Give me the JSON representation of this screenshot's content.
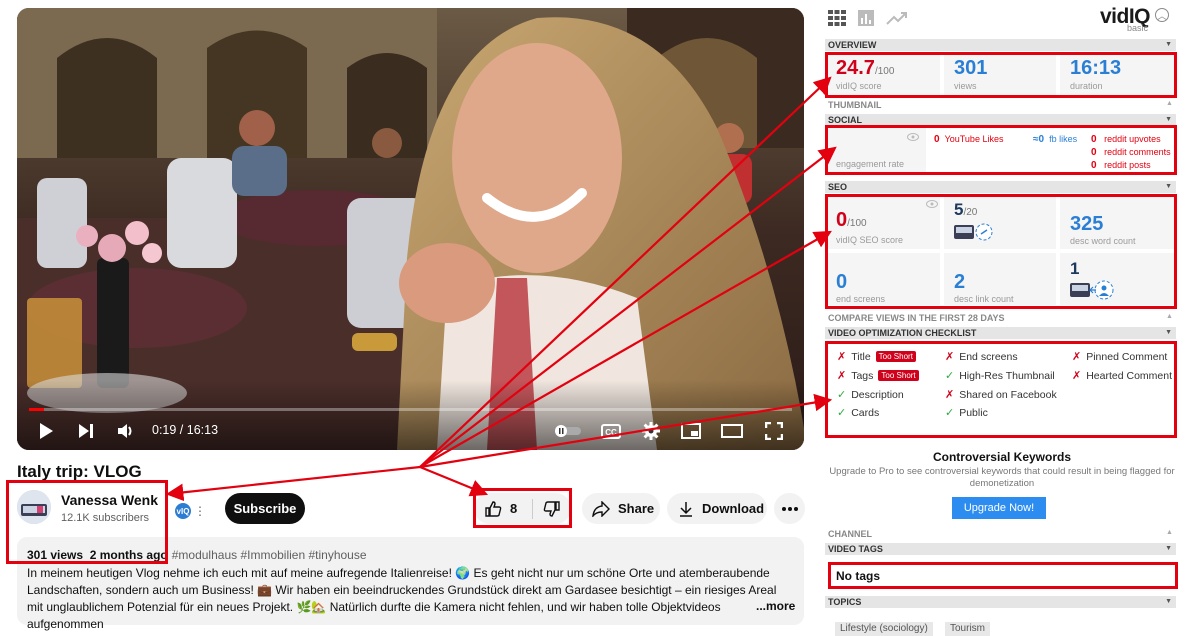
{
  "player": {
    "time": "0:19 / 16:13",
    "progress_fraction": 0.02
  },
  "video": {
    "title": "Italy trip: VLOG"
  },
  "channel": {
    "name": "Vanessa Wenk",
    "subscribers": "12.1K subscribers",
    "subscribe_label": "Subscribe",
    "vidiq_badge": "vIQ"
  },
  "actions": {
    "likes": "8",
    "share": "Share",
    "download": "Download"
  },
  "description": {
    "views": "301 views",
    "age": "2 months ago",
    "hashtags": "#modulhaus #Immobilien #tinyhouse",
    "text": "In meinem heutigen Vlog nehme ich euch mit auf meine aufregende Italienreise! 🌍 Es geht nicht nur um schöne Orte und atemberaubende Landschaften, sondern auch um Business! 💼 Wir haben ein beeindruckendes Grundstück direkt am Gardasee besichtigt – ein riesiges Areal mit unglaublichem Potenzial für ein neues Projekt. 🌿🏡 Natürlich durfte die Kamera nicht fehlen, und wir haben tolle Objektvideos aufgenommen",
    "more": "...more"
  },
  "vidiq": {
    "logo_main": "vid",
    "logo_iq": "IQ",
    "plan": "basic",
    "sections": {
      "overview": "OVERVIEW",
      "thumbnail": "THUMBNAIL",
      "social": "SOCIAL",
      "seo": "SEO",
      "compare": "COMPARE VIEWS IN THE FIRST 28 DAYS",
      "checklist": "VIDEO OPTIMIZATION CHECKLIST",
      "channel": "CHANNEL",
      "tags": "VIDEO TAGS",
      "topics": "TOPICS"
    },
    "overview": {
      "score": "24.7",
      "score_max": "/100",
      "score_label": "vidIQ score",
      "views": "301",
      "views_label": "views",
      "duration": "16:13",
      "duration_label": "duration"
    },
    "social": {
      "engagement_label": "engagement rate",
      "yt_likes_num": "0",
      "yt_likes_label": "YouTube Likes",
      "fb_num": "≈0",
      "fb_label": "fb likes",
      "reddit_upvotes_num": "0",
      "reddit_upvotes_label": "reddit upvotes",
      "reddit_comments_num": "0",
      "reddit_comments_label": "reddit comments",
      "reddit_posts_num": "0",
      "reddit_posts_label": "reddit posts"
    },
    "seo": {
      "score": "0",
      "score_max": "/100",
      "score_label": "vidIQ SEO score",
      "tags_count": "5",
      "tags_max": "/20",
      "desc_words": "325",
      "desc_words_label": "desc word count",
      "end_screens": "0",
      "end_screens_label": "end screens",
      "desc_links": "2",
      "desc_links_label": "desc link count",
      "cards": "1"
    },
    "checklist": {
      "title": "Title",
      "title_badge": "Too Short",
      "tags": "Tags",
      "tags_badge": "Too Short",
      "description": "Description",
      "cards": "Cards",
      "end_screens": "End screens",
      "hires_thumb": "High-Res Thumbnail",
      "shared_fb": "Shared on Facebook",
      "public": "Public",
      "pinned": "Pinned Comment",
      "hearted": "Hearted Comment"
    },
    "controversial": {
      "title": "Controversial Keywords",
      "body": "Upgrade to Pro to see controversial keywords that could result in being flagged for demonetization",
      "button": "Upgrade Now!"
    },
    "video_tags": "No tags",
    "topics": [
      "Lifestyle (sociology)",
      "Tourism"
    ]
  },
  "colors": {
    "annotation_red": "#e3000f",
    "vidiq_blue": "#2a7fd5",
    "score_red": "#d0021b",
    "youtube_red": "#ff0000"
  }
}
